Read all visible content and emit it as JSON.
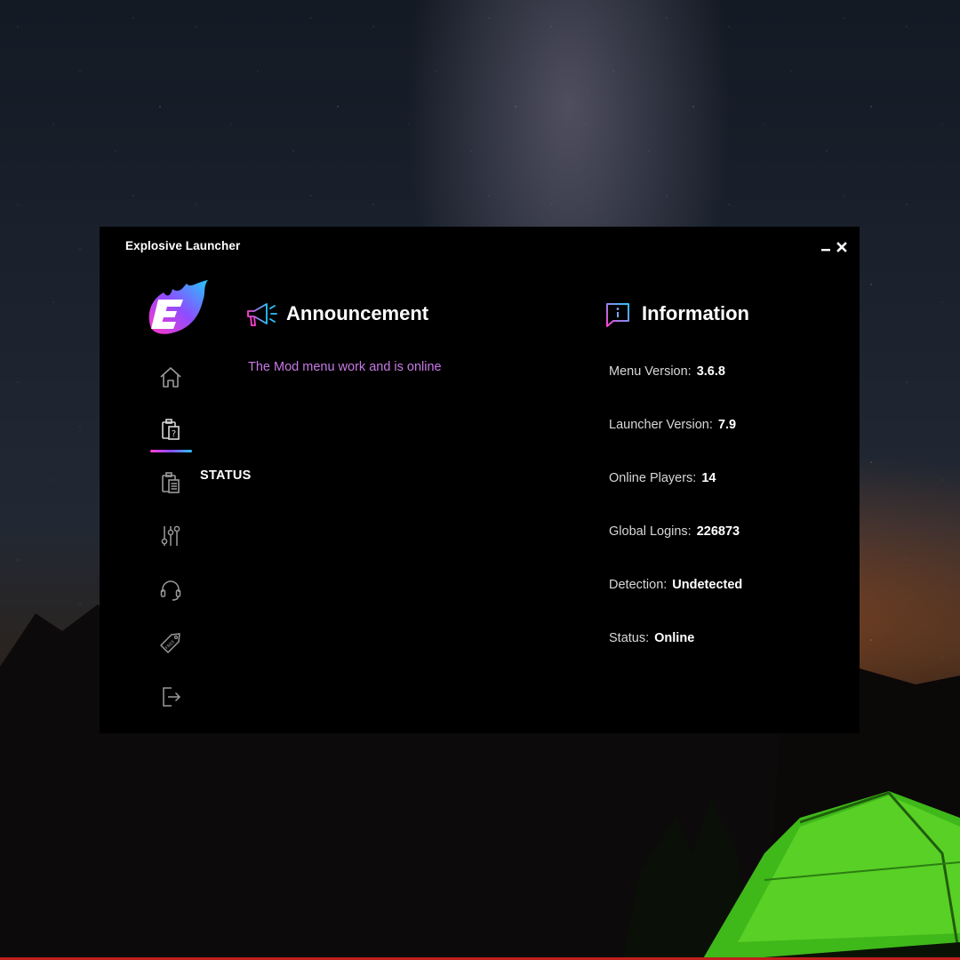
{
  "window": {
    "title": "Explosive Launcher",
    "controls": [
      "minimize-icon",
      "close-icon"
    ]
  },
  "sidebar": {
    "logo_letter": "E",
    "items": [
      {
        "icon": "home-icon",
        "active": false
      },
      {
        "icon": "clipboard-question-icon",
        "active": true
      },
      {
        "icon": "clipboard-list-icon",
        "active": false,
        "label": "STATUS"
      },
      {
        "icon": "sliders-icon",
        "active": false
      },
      {
        "icon": "headset-icon",
        "active": false
      },
      {
        "icon": "free-tag-icon",
        "active": false,
        "tag_text": "FREE"
      },
      {
        "icon": "logout-icon",
        "active": false
      }
    ]
  },
  "announcement": {
    "title": "Announcement",
    "icon": "megaphone-icon",
    "message": "The Mod menu work and is online"
  },
  "information": {
    "title": "Information",
    "icon": "info-chat-icon",
    "rows": [
      {
        "label": "Menu Version:",
        "value": "3.6.8"
      },
      {
        "label": "Launcher Version:",
        "value": "7.9"
      },
      {
        "label": "Online Players:",
        "value": "14"
      },
      {
        "label": "Global Logins:",
        "value": "226873"
      },
      {
        "label": "Detection:",
        "value": "Undetected"
      },
      {
        "label": "Status:",
        "value": "Online"
      }
    ]
  },
  "colors": {
    "window_bg": "#000000",
    "announcement_text": "#c87ae6",
    "accent_pink": "#ff3fd0",
    "accent_purple": "#8a4dff",
    "accent_cyan": "#29c6ff",
    "taskbar_red": "#c0201c"
  }
}
